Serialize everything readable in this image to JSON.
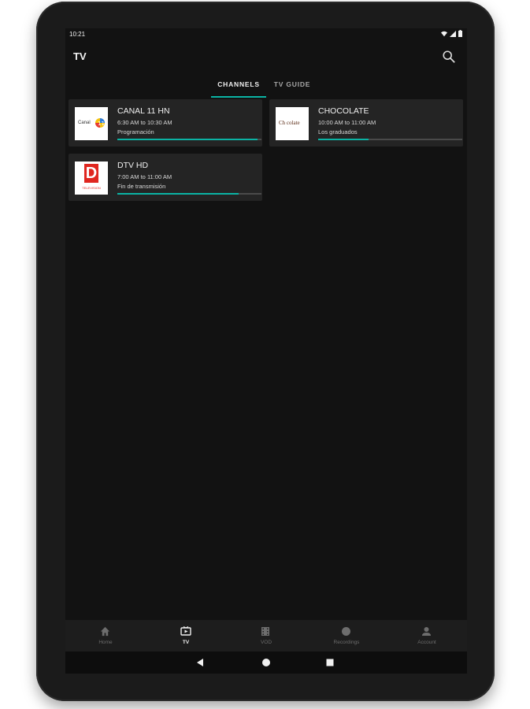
{
  "status_bar": {
    "time": "10:21",
    "icons": [
      "wifi-icon",
      "signal-icon",
      "battery-icon"
    ]
  },
  "app_bar": {
    "title": "TV",
    "search_icon": "search-icon"
  },
  "tabs": [
    {
      "label": "CHANNELS",
      "active": true
    },
    {
      "label": "TV GUIDE",
      "active": false
    }
  ],
  "channels": [
    {
      "name": "CANAL 11 HN",
      "time": "6:30 AM to 10:30 AM",
      "program": "Programación",
      "progress": 0.97,
      "logo_text": "Canal"
    },
    {
      "name": "CHOCOLATE",
      "time": "10:00 AM to 11:00 AM",
      "program": "Los graduados",
      "progress": 0.35,
      "logo_text": "Ch colate"
    },
    {
      "name": "DTV HD",
      "time": "7:00 AM to 11:00 AM",
      "program": "Fin de transmisión",
      "progress": 0.84,
      "logo_text": "D",
      "logo_subtext": "TELEVISION"
    }
  ],
  "bottom_nav": [
    {
      "label": "Home",
      "icon": "home-icon",
      "active": false
    },
    {
      "label": "TV",
      "icon": "tv-icon",
      "active": true
    },
    {
      "label": "VOD",
      "icon": "vod-icon",
      "active": false
    },
    {
      "label": "Recordings",
      "icon": "record-icon",
      "active": false
    },
    {
      "label": "Account",
      "icon": "account-icon",
      "active": false
    }
  ],
  "colors": {
    "accent": "#0bb3a4",
    "background": "#121212",
    "card": "#242424",
    "dtv_red": "#e0261f"
  }
}
